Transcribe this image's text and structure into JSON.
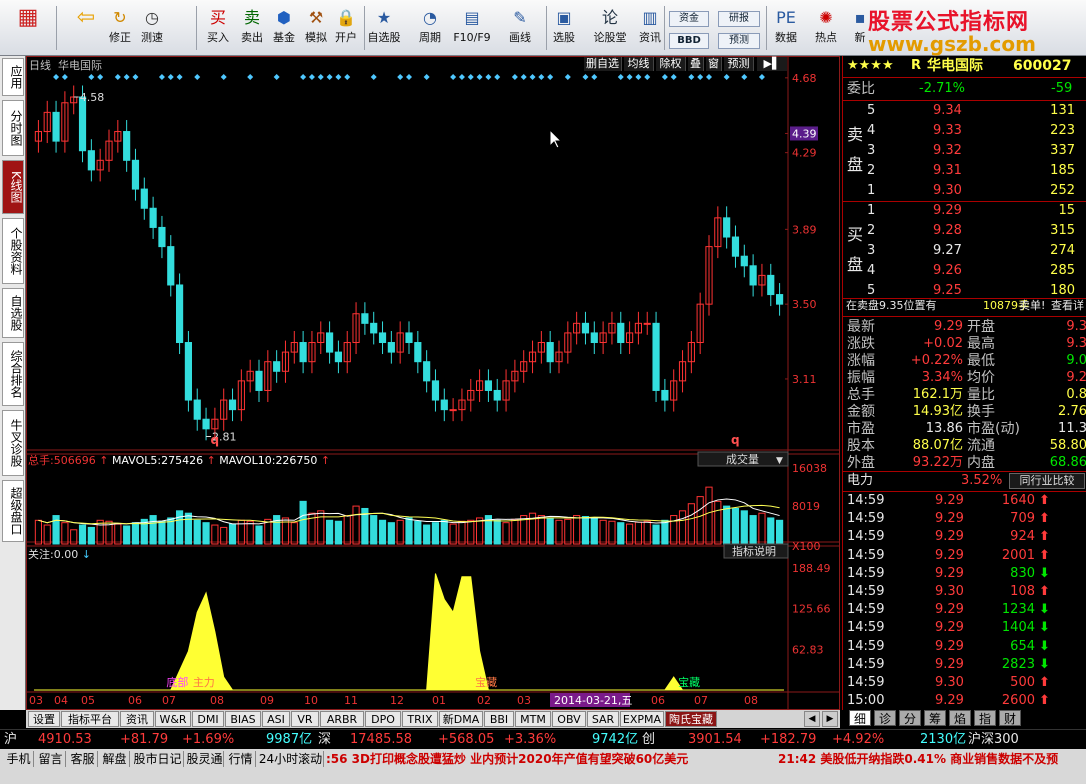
{
  "toolbar": {
    "buttons": [
      {
        "label": "",
        "icon": "grid-icon"
      },
      {
        "label": "",
        "icon": "back-arrow-icon"
      },
      {
        "label": "修正",
        "icon": "refresh-icon"
      },
      {
        "label": "测速",
        "icon": "clock-icon"
      },
      {
        "label": "买入",
        "icon": "buy-icon",
        "glyph": "买"
      },
      {
        "label": "卖出",
        "icon": "sell-icon",
        "glyph": "卖"
      },
      {
        "label": "基金",
        "icon": "fund-icon"
      },
      {
        "label": "模拟",
        "icon": "hammer-icon"
      },
      {
        "label": "开户",
        "icon": "lock-icon"
      },
      {
        "label": "自选股",
        "icon": "star-list-icon"
      },
      {
        "label": "周期",
        "icon": "cycle-icon"
      },
      {
        "label": "F10/F9",
        "icon": "book-icon"
      },
      {
        "label": "画线",
        "icon": "pen-icon"
      },
      {
        "label": "选股",
        "icon": "screen-icon"
      },
      {
        "label": "论股堂",
        "icon": "discuss-icon",
        "glyph": "论"
      },
      {
        "label": "资讯",
        "icon": "news-icon"
      },
      {
        "label": "数据",
        "icon": "pe-icon"
      },
      {
        "label": "热点",
        "icon": "hot-icon"
      },
      {
        "label": "新",
        "icon": "new-icon"
      }
    ],
    "mini": {
      "zijin": "资金",
      "bbd": "BBD",
      "yanbao": "研报",
      "yuce": "预测"
    },
    "banner1": "股票公式指标网",
    "banner2": "www.gszb.com"
  },
  "sidetabs": [
    {
      "label": "应用",
      "active": false
    },
    {
      "label": "分时图",
      "active": false
    },
    {
      "label": "K线图",
      "active": true
    },
    {
      "label": "个股资料",
      "active": false
    },
    {
      "label": "自选股",
      "active": false
    },
    {
      "label": "综合排名",
      "active": false
    },
    {
      "label": "牛叉诊股",
      "active": false
    },
    {
      "label": "超级盘口",
      "active": false
    }
  ],
  "chart": {
    "period": "日线",
    "name": "华电国际",
    "buttons": [
      "删自选",
      "均线",
      "除权",
      "叠",
      "窗",
      "预测"
    ],
    "price_axis": [
      "4.68",
      "4.39",
      "4.29",
      "3.89",
      "3.50",
      "3.11"
    ],
    "high_label": "4.58",
    "low_label": "2.81",
    "q1": "q",
    "q2": "q",
    "vol_header": {
      "total_label": "总手:",
      "total": "506696",
      "ma5_label": "MAVOL5:",
      "ma5": "275426",
      "ma10_label": "MAVOL10:",
      "ma10": "226750"
    },
    "vol_dropdown": "成交量",
    "vol_axis": [
      "16038",
      "8019",
      "X100"
    ],
    "ind_header": {
      "label": "关注:",
      "value": "0.00"
    },
    "ind_button": "指标说明",
    "ind_axis": [
      "188.49",
      "125.66",
      "62.83"
    ],
    "ind_tag1": "底部",
    "ind_tag2": "主力",
    "ind_tag3": "宝藏",
    "ind_tag4": "宝藏",
    "date_axis": [
      "03",
      "04",
      "05",
      "06",
      "07",
      "08",
      "09",
      "10",
      "11",
      "12",
      "01",
      "02",
      "03",
      "2014-03-21,五",
      "06",
      "07",
      "08"
    ],
    "chart_data": {
      "type": "candlestick",
      "price_range": [
        2.75,
        4.7
      ],
      "high": 4.58,
      "low": 2.81,
      "close": [
        4.4,
        4.5,
        4.35,
        4.55,
        4.58,
        4.3,
        4.2,
        4.25,
        4.35,
        4.4,
        4.25,
        4.1,
        4.0,
        3.9,
        3.8,
        3.6,
        3.3,
        3.0,
        2.9,
        2.85,
        2.9,
        3.0,
        2.95,
        3.1,
        3.15,
        3.05,
        3.2,
        3.15,
        3.25,
        3.3,
        3.2,
        3.3,
        3.35,
        3.25,
        3.2,
        3.3,
        3.45,
        3.4,
        3.35,
        3.3,
        3.25,
        3.35,
        3.3,
        3.2,
        3.1,
        3.0,
        2.95,
        2.95,
        3.0,
        3.05,
        3.1,
        3.05,
        3.0,
        3.1,
        3.15,
        3.2,
        3.25,
        3.3,
        3.2,
        3.25,
        3.35,
        3.4,
        3.35,
        3.3,
        3.35,
        3.4,
        3.3,
        3.35,
        3.4,
        3.4,
        3.05,
        3.0,
        3.1,
        3.2,
        3.3,
        3.5,
        3.8,
        3.95,
        3.85,
        3.75,
        3.7,
        3.6,
        3.65,
        3.55,
        3.5
      ],
      "volume": [
        5000,
        4000,
        6000,
        4500,
        3000,
        4000,
        3500,
        5000,
        4800,
        4200,
        3800,
        4500,
        5200,
        6000,
        4800,
        5500,
        7000,
        6500,
        5000,
        4500,
        4000,
        3500,
        4200,
        5000,
        4800,
        3800,
        5200,
        6000,
        5500,
        4500,
        9000,
        6500,
        7000,
        5000,
        4800,
        6000,
        8000,
        7500,
        6000,
        5000,
        4500,
        5000,
        5500,
        4800,
        4000,
        4500,
        5000,
        4200,
        4800,
        5000,
        5500,
        6000,
        5000,
        4500,
        5200,
        6000,
        6500,
        6000,
        5500,
        5000,
        5200,
        6000,
        5800,
        5500,
        5000,
        4800,
        4500,
        4200,
        4600,
        4800,
        4000,
        5000,
        6000,
        7000,
        8500,
        10000,
        12000,
        9000,
        8000,
        7500,
        7000,
        6000,
        6500,
        5500,
        5000
      ],
      "indicator": [
        0,
        0,
        0,
        0,
        0,
        0,
        0,
        0,
        0,
        0,
        0,
        0,
        0,
        0,
        0,
        0,
        30,
        60,
        120,
        150,
        90,
        20,
        0,
        0,
        0,
        0,
        0,
        0,
        0,
        0,
        0,
        0,
        0,
        0,
        0,
        0,
        0,
        0,
        0,
        0,
        0,
        0,
        0,
        0,
        0,
        180,
        140,
        120,
        175,
        175,
        60,
        0,
        0,
        0,
        0,
        0,
        0,
        0,
        0,
        0,
        0,
        0,
        0,
        0,
        0,
        0,
        0,
        0,
        0,
        0,
        0,
        0,
        20,
        0,
        0,
        0,
        0,
        0,
        0,
        0,
        0,
        0,
        0,
        0,
        0
      ]
    }
  },
  "right": {
    "stars": "★★★★",
    "rflag": "R",
    "stock": "华电国际",
    "code": "600027",
    "weibi_label": "委比",
    "weibi": "-2.71%",
    "weicha": "-59",
    "sell_label1": "卖",
    "sell_label2": "盘",
    "buy_label1": "买",
    "buy_label2": "盘",
    "sell": [
      {
        "n": "5",
        "p": "9.34",
        "v": "131"
      },
      {
        "n": "4",
        "p": "9.33",
        "v": "223"
      },
      {
        "n": "3",
        "p": "9.32",
        "v": "337"
      },
      {
        "n": "2",
        "p": "9.31",
        "v": "185"
      },
      {
        "n": "1",
        "p": "9.30",
        "v": "252"
      }
    ],
    "buy": [
      {
        "n": "1",
        "p": "9.29",
        "v": "15"
      },
      {
        "n": "2",
        "p": "9.28",
        "v": "315"
      },
      {
        "n": "3",
        "p": "9.27",
        "v": "274"
      },
      {
        "n": "4",
        "p": "9.26",
        "v": "285"
      },
      {
        "n": "5",
        "p": "9.25",
        "v": "180"
      }
    ],
    "notice": "在卖盘9.35位置有",
    "notice_vol": "10879手",
    "notice_act": "卖单!",
    "notice_link": "查看详",
    "quotes": [
      {
        "l1": "最新",
        "v1": "9.29",
        "l2": "开盘",
        "v2": "9.3"
      },
      {
        "l1": "涨跌",
        "v1": "+0.02",
        "l2": "最高",
        "v2": "9.3"
      },
      {
        "l1": "涨幅",
        "v1": "+0.22%",
        "l2": "最低",
        "v2": "9.0"
      },
      {
        "l1": "振幅",
        "v1": "3.34%",
        "l2": "均价",
        "v2": "9.2"
      },
      {
        "l1": "总手",
        "v1": "162.1万",
        "l2": "量比",
        "v2": "0.8"
      },
      {
        "l1": "金额",
        "v1": "14.93亿",
        "l2": "换手",
        "v2": "2.76"
      },
      {
        "l1": "市盈",
        "v1": "13.86",
        "l2": "市盈(动)",
        "v2": "11.3"
      },
      {
        "l1": "股本",
        "v1": "88.07亿",
        "l2": "流通",
        "v2": "58.80"
      },
      {
        "l1": "外盘",
        "v1": "93.22万",
        "l2": "内盘",
        "v2": "68.86"
      }
    ],
    "sector": "电力",
    "sector_pct": "3.52%",
    "sector_btn": "同行业比较",
    "ticks": [
      {
        "t": "14:59",
        "p": "9.29",
        "v": "1640",
        "d": "up"
      },
      {
        "t": "14:59",
        "p": "9.29",
        "v": "709",
        "d": "up"
      },
      {
        "t": "14:59",
        "p": "9.29",
        "v": "924",
        "d": "up"
      },
      {
        "t": "14:59",
        "p": "9.29",
        "v": "2001",
        "d": "up"
      },
      {
        "t": "14:59",
        "p": "9.29",
        "v": "830",
        "d": "down"
      },
      {
        "t": "14:59",
        "p": "9.30",
        "v": "108",
        "d": "up"
      },
      {
        "t": "14:59",
        "p": "9.29",
        "v": "1234",
        "d": "down"
      },
      {
        "t": "14:59",
        "p": "9.29",
        "v": "1404",
        "d": "down"
      },
      {
        "t": "14:59",
        "p": "9.29",
        "v": "654",
        "d": "down"
      },
      {
        "t": "14:59",
        "p": "9.29",
        "v": "2823",
        "d": "down"
      },
      {
        "t": "14:59",
        "p": "9.30",
        "v": "500",
        "d": "up"
      },
      {
        "t": "15:00",
        "p": "9.29",
        "v": "2600",
        "d": "up"
      }
    ],
    "bottom_tabs": [
      "细",
      "诊",
      "分",
      "筹",
      "焰",
      "指",
      "财"
    ]
  },
  "bottom_tabs": [
    "设置",
    "指标平台",
    "资讯",
    "W&R",
    "DMI",
    "BIAS",
    "ASI",
    "VR",
    "ARBR",
    "DPO",
    "TRIX",
    "新DMA",
    "BBI",
    "MTM",
    "OBV",
    "SAR",
    "EXPMA",
    "陶氏宝藏"
  ],
  "index_row": {
    "sh_label": "沪",
    "sh": "4910.53",
    "sh_ch": "+81.79",
    "sh_pct": "+1.69%",
    "sh_amt": "9987亿",
    "sz_label": "深",
    "sz": "17485.58",
    "sz_ch": "+568.05",
    "sz_pct": "+3.36%",
    "sz_amt": "9742亿",
    "cy_label": "创",
    "cy": "3901.54",
    "cy_ch": "+182.79",
    "cy_pct": "+4.92%",
    "cy_amt": "2130亿",
    "hs_label": "沪深300"
  },
  "status": {
    "tabs": [
      "手机",
      "留言",
      "客服",
      "解盘",
      "股市日记",
      "股灵通",
      "行情",
      "24小时滚动"
    ],
    "news1": ":56 3D打印概念股遭猛炒 业内预计2020年产值有望突破60亿美元",
    "news2": "21:42 美股低开纳指跌0.41% 商业销售数据不及预"
  }
}
